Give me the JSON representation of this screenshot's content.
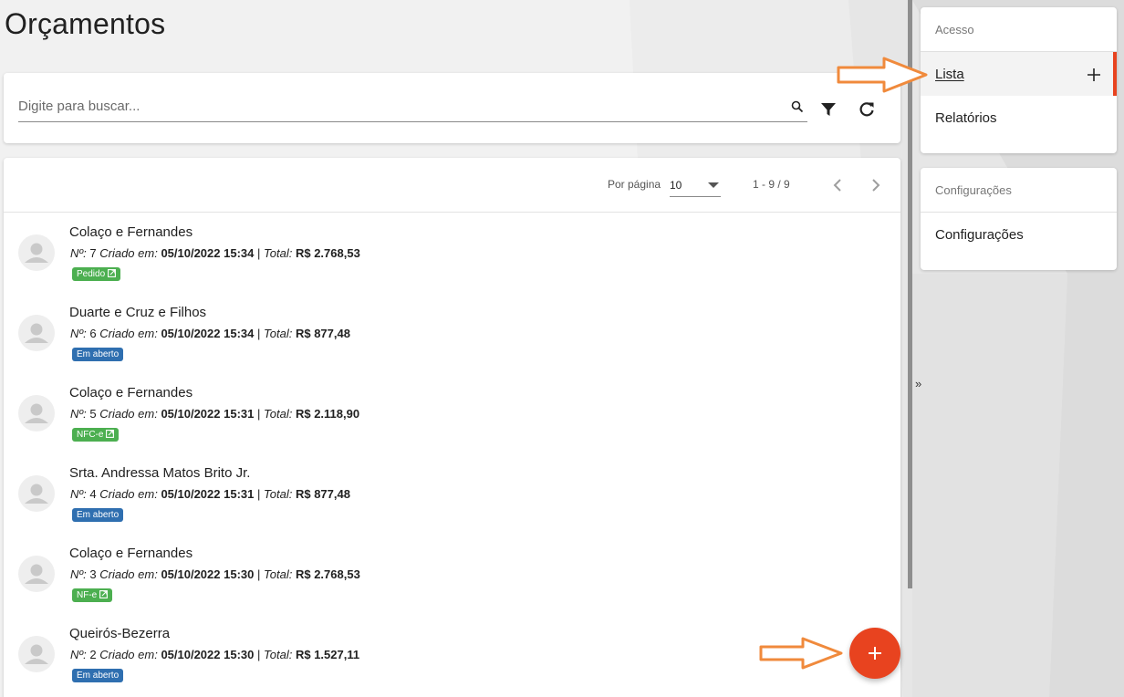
{
  "page": {
    "title": "Orçamentos"
  },
  "search": {
    "placeholder": "Digite para buscar..."
  },
  "pager": {
    "per_page_label": "Por página",
    "per_page_value": "10",
    "range": "1 - 9 / 9"
  },
  "labels": {
    "number": "Nº:",
    "created": "Criado em:",
    "total": "Total:",
    "separator": "|"
  },
  "orders": [
    {
      "name": "Colaço e Fernandes",
      "number": "7",
      "created": "05/10/2022 15:34",
      "total": "R$ 2.768,53",
      "status": "Pedido",
      "status_color": "#4caf50",
      "external": true
    },
    {
      "name": "Duarte e Cruz e Filhos",
      "number": "6",
      "created": "05/10/2022 15:34",
      "total": "R$ 877,48",
      "status": "Em aberto",
      "status_color": "#2f6fb0",
      "external": false
    },
    {
      "name": "Colaço e Fernandes",
      "number": "5",
      "created": "05/10/2022 15:31",
      "total": "R$ 2.118,90",
      "status": "NFC-e",
      "status_color": "#4caf50",
      "external": true
    },
    {
      "name": "Srta. Andressa Matos Brito Jr.",
      "number": "4",
      "created": "05/10/2022 15:31",
      "total": "R$ 877,48",
      "status": "Em aberto",
      "status_color": "#2f6fb0",
      "external": false
    },
    {
      "name": "Colaço e Fernandes",
      "number": "3",
      "created": "05/10/2022 15:30",
      "total": "R$ 2.768,53",
      "status": "NF-e",
      "status_color": "#4caf50",
      "external": true
    },
    {
      "name": "Queirós-Bezerra",
      "number": "2",
      "created": "05/10/2022 15:30",
      "total": "R$ 1.527,11",
      "status": "Em aberto",
      "status_color": "#2f6fb0",
      "external": false
    }
  ],
  "sidebar": {
    "collapse_label": "»",
    "groups": [
      {
        "header": "Acesso",
        "items": [
          {
            "label": "Lista",
            "active": true,
            "has_add": true
          },
          {
            "label": "Relatórios",
            "active": false
          }
        ]
      },
      {
        "header": "Configurações",
        "items": [
          {
            "label": "Configurações",
            "active": false
          }
        ]
      }
    ]
  },
  "colors": {
    "accent": "#e8431f",
    "annotation_arrow": "#f08a3c",
    "pedido": "#4caf50",
    "em_aberto": "#2f6fb0"
  },
  "icons": [
    "search-icon",
    "filter-icon",
    "refresh-icon",
    "chevron-left-icon",
    "chevron-right-icon",
    "add-icon",
    "avatar-icon",
    "open-external-icon"
  ]
}
